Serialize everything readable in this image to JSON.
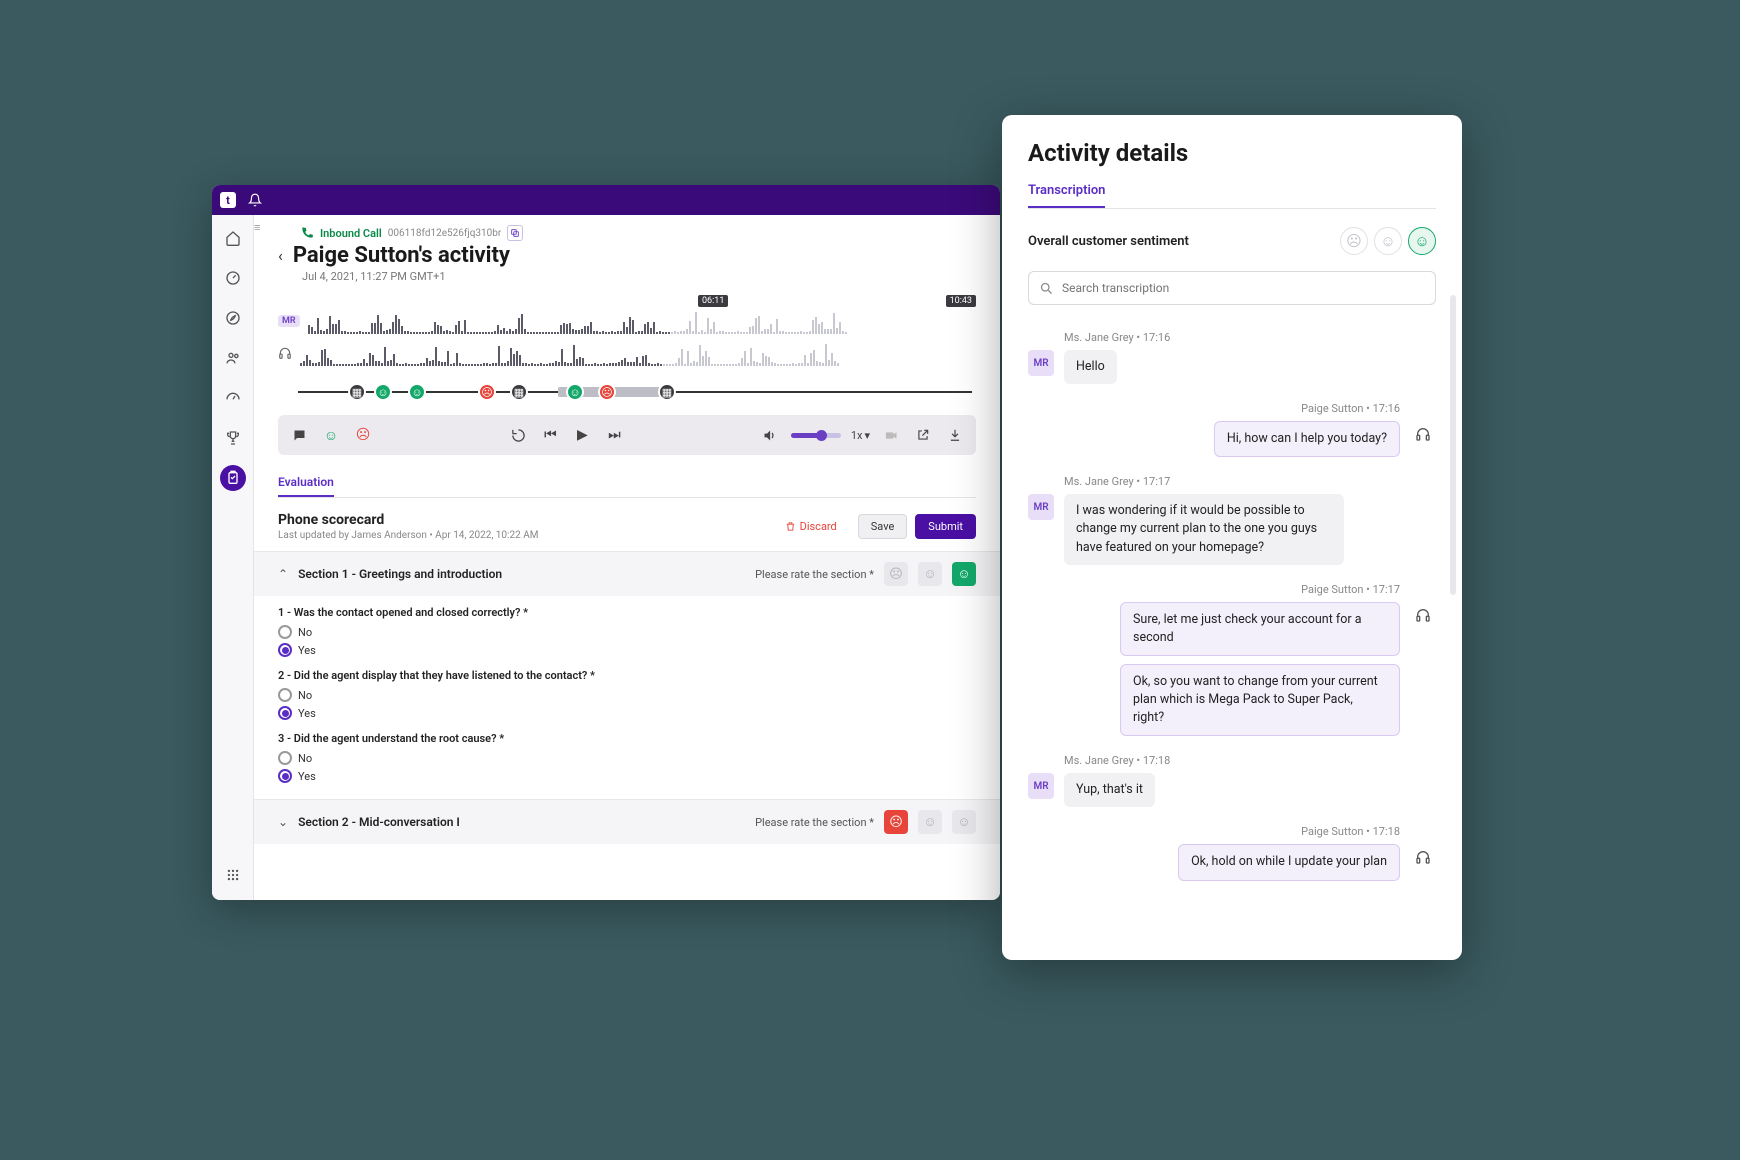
{
  "topbar": {
    "logo_text": "t"
  },
  "sidebar": {
    "items": [
      {
        "name": "home-icon"
      },
      {
        "name": "gauge-icon"
      },
      {
        "name": "compass-icon"
      },
      {
        "name": "people-icon"
      },
      {
        "name": "speedometer-icon"
      },
      {
        "name": "trophy-icon"
      },
      {
        "name": "clipboard-icon",
        "active": true
      }
    ]
  },
  "header": {
    "call_type": "Inbound Call",
    "call_id": "006118fd12e526fjq310br",
    "title": "Paige Sutton's activity",
    "timestamp": "Jul 4, 2021, 11:27 PM GMT+1"
  },
  "waveform": {
    "speaker_badge": "MR",
    "time_marker_a": "06:11",
    "time_marker_b": "10:43"
  },
  "player": {
    "speed": "1x"
  },
  "eval_tab": "Evaluation",
  "scorecard": {
    "title": "Phone scorecard",
    "subtitle": "Last updated by James Anderson  •  Apr 14, 2022, 10:22 AM",
    "discard": "Discard",
    "save": "Save",
    "submit": "Submit"
  },
  "sections": [
    {
      "title": "Section 1 - Greetings and introduction",
      "rate_label": "Please rate the section *",
      "rated": "good",
      "expanded": true,
      "questions": [
        {
          "label": "1 - Was the contact opened and closed correctly? *",
          "no": "No",
          "yes": "Yes",
          "answer": "yes"
        },
        {
          "label": "2 - Did the agent display that they have listened to the contact? *",
          "no": "No",
          "yes": "Yes",
          "answer": "yes"
        },
        {
          "label": "3 - Did the agent understand the root cause? *",
          "no": "No",
          "yes": "Yes",
          "answer": "yes"
        }
      ]
    },
    {
      "title": "Section 2 - Mid-conversation I",
      "rate_label": "Please rate the section *",
      "rated": "bad",
      "expanded": false
    }
  ],
  "details": {
    "title": "Activity details",
    "tab": "Transcription",
    "sentiment_label": "Overall customer sentiment",
    "search_placeholder": "Search transcription",
    "customer_badge": "MR",
    "messages": [
      {
        "side": "cust",
        "meta": "Ms. Jane Grey  •  17:16",
        "text": "Hello"
      },
      {
        "side": "agent",
        "meta": "Paige Sutton  •  17:16",
        "text": "Hi, how can I help you today?"
      },
      {
        "side": "cust",
        "meta": "Ms. Jane Grey  •  17:17",
        "text": "I was wondering if it would be possible to change my current plan to the one you guys have featured on your homepage?"
      },
      {
        "side": "agent",
        "meta": "Paige Sutton  •  17:17",
        "text": "Sure, let me just check your account for a second",
        "text2": "Ok, so you want to change from your current plan which is Mega Pack to Super Pack, right?"
      },
      {
        "side": "cust",
        "meta": "Ms. Jane Grey  •  17:18",
        "text": "Yup, that's it"
      },
      {
        "side": "agent",
        "meta": "Paige Sutton  •  17:18",
        "text": "Ok, hold on while I update your plan"
      }
    ]
  }
}
